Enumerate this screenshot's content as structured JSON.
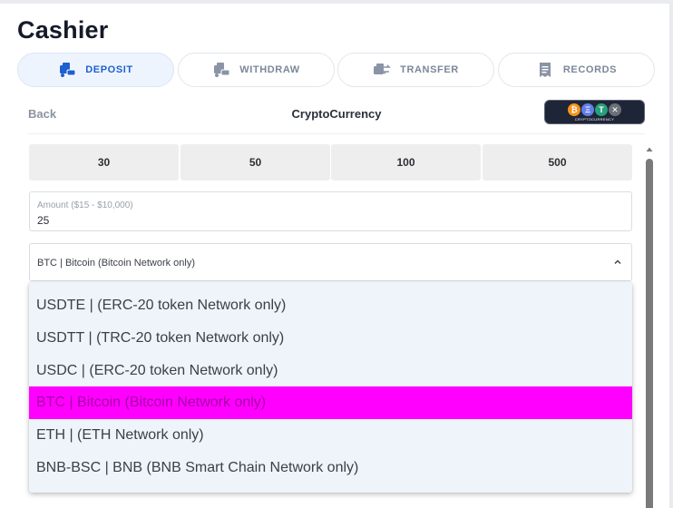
{
  "page": {
    "title": "Cashier"
  },
  "tabs": [
    {
      "label": "DEPOSIT",
      "icon": "deposit-icon",
      "active": true
    },
    {
      "label": "WITHDRAW",
      "icon": "withdraw-icon",
      "active": false
    },
    {
      "label": "TRANSFER",
      "icon": "transfer-icon",
      "active": false
    },
    {
      "label": "RECORDS",
      "icon": "records-icon",
      "active": false
    }
  ],
  "subheader": {
    "back_label": "Back",
    "section_title": "CryptoCurrency",
    "badge": {
      "coins": [
        "₿",
        "Ξ",
        "T",
        "✕"
      ],
      "text": "CRYPTOCURRENCY"
    }
  },
  "amount_presets": [
    "30",
    "50",
    "100",
    "500"
  ],
  "amount_field": {
    "label": "Amount ($15 - $10,000)",
    "value": "25"
  },
  "currency_select": {
    "selected": "BTC | Bitcoin (Bitcoin Network only)",
    "options": [
      "USDTE | (ERC-20 token Network only)",
      "USDTT | (TRC-20 token Network only)",
      "USDC | (ERC-20 token Network only)",
      "BTC | Bitcoin (Bitcoin Network only)",
      "ETH | (ETH Network only)",
      "BNB-BSC | BNB (BNB Smart Chain Network only)"
    ],
    "selected_index": 3
  },
  "colors": {
    "accent": "#1e5fd1",
    "highlight": "#ff00ff",
    "bitcoin": "#f7931a",
    "ethereum": "#627eea",
    "tether": "#26a17b",
    "x_coin": "#6b6f78"
  }
}
